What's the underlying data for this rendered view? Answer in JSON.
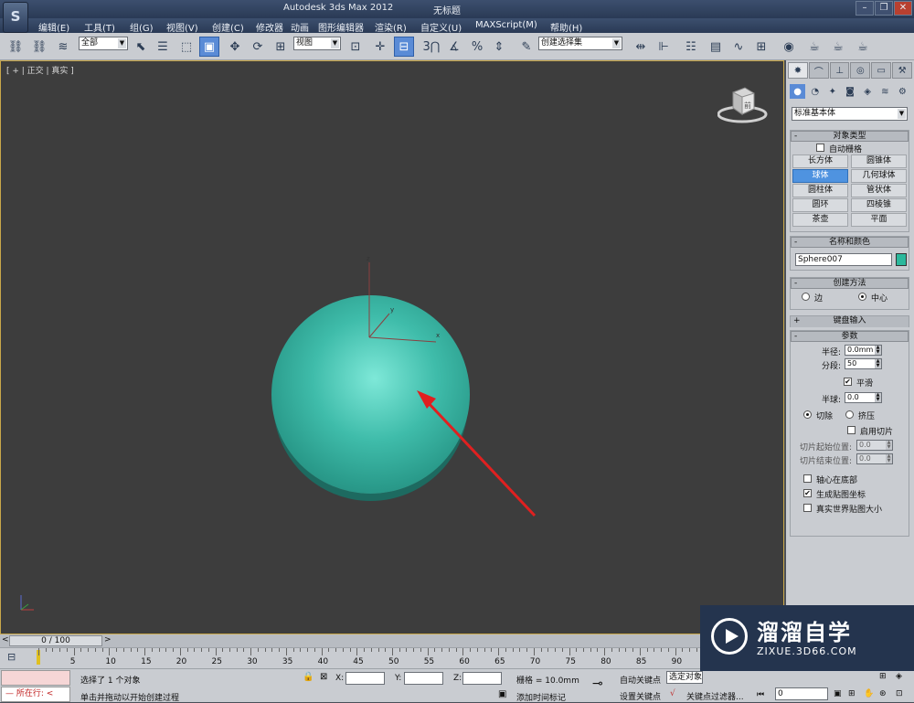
{
  "window": {
    "app_icon": "3ds-max-logo",
    "title": "Autodesk 3ds Max  2012",
    "doc_title": "无标题",
    "controls": [
      "minimize-icon",
      "restore-icon",
      "close-icon"
    ]
  },
  "menu": [
    "编辑(E)",
    "工具(T)",
    "组(G)",
    "视图(V)",
    "创建(C)",
    "修改器",
    "动画",
    "图形编辑器",
    "渲染(R)",
    "自定义(U)",
    "MAXScript(M)",
    "帮助(H)"
  ],
  "toolbar": {
    "selection_filter": "全部",
    "reference_coord": "视图",
    "named_selection": "创建选择集",
    "snap_3": "3"
  },
  "viewport": {
    "label": "[ + | 正交 | 真实 ]",
    "cube_face": "前",
    "axis_labels": [
      "z",
      "y",
      "x"
    ]
  },
  "panel": {
    "tabs": [
      "create-tab",
      "modify-tab",
      "hierarchy-tab",
      "motion-tab",
      "display-tab",
      "utilities-tab"
    ],
    "category": "标准基本体",
    "object_type": {
      "header": "对象类型",
      "autogrid": "自动栅格",
      "buttons": [
        "长方体",
        "圆锥体",
        "球体",
        "几何球体",
        "圆柱体",
        "管状体",
        "圆环",
        "四棱锥",
        "茶壶",
        "平面"
      ],
      "active": "球体"
    },
    "name_color": {
      "header": "名称和颜色",
      "name": "Sphere007",
      "swatch": "#2bb89c"
    },
    "creation_method": {
      "header": "创建方法",
      "edge": "边",
      "center": "中心"
    },
    "keyboard_entry": {
      "header": "键盘输入"
    },
    "parameters": {
      "header": "参数",
      "radius_label": "半径:",
      "radius": "0.0mm",
      "segments_label": "分段:",
      "segments": "50",
      "smooth": "平滑",
      "hemisphere_label": "半球:",
      "hemisphere": "0.0",
      "chop": "切除",
      "squash": "挤压",
      "enable_slice": "启用切片",
      "slice_from_label": "切片起始位置:",
      "slice_from": "0.0",
      "slice_to_label": "切片结束位置:",
      "slice_to": "0.0",
      "base_to_pivot": "轴心在底部",
      "gen_map": "生成贴图坐标",
      "real_world": "真实世界贴图大小"
    }
  },
  "timeline": {
    "slider": "0 / 100",
    "ticks": [
      "5",
      "10",
      "15",
      "20",
      "25",
      "30",
      "35",
      "40",
      "45",
      "50",
      "55",
      "60",
      "65",
      "70",
      "75",
      "80",
      "85",
      "90"
    ]
  },
  "status": {
    "maxscript_prompt": "所在行:",
    "selection": "选择了 1 个对象",
    "hint": "单击并拖动以开始创建过程",
    "x_label": "X:",
    "y_label": "Y:",
    "z_label": "Z:",
    "grid": "栅格 = 10.0mm",
    "add_time_tag": "添加时间标记",
    "auto_key": "自动关键点",
    "selected": "选定对象",
    "set_key": "设置关键点",
    "key_filters": "关键点过滤器...",
    "frame": "0"
  },
  "watermark": {
    "title": "溜溜自学",
    "url": "ZIXUE.3D66.COM"
  }
}
